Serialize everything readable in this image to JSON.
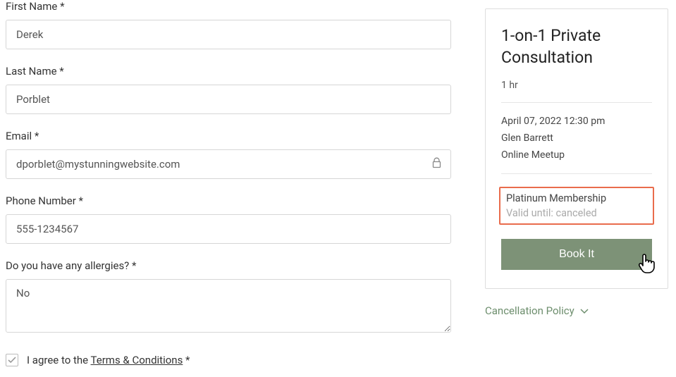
{
  "form": {
    "first_name": {
      "label": "First Name *",
      "value": "Derek"
    },
    "last_name": {
      "label": "Last Name *",
      "value": "Porblet"
    },
    "email": {
      "label": "Email *",
      "value": "dporblet@mystunningwebsite.com"
    },
    "phone": {
      "label": "Phone Number *",
      "value": "555-1234567"
    },
    "allergies": {
      "label": "Do you have any allergies? *",
      "value": "No"
    },
    "agree_prefix": "I agree to the ",
    "terms_link": "Terms & Conditions",
    "agree_suffix": " *"
  },
  "summary": {
    "title": "1-on-1 Private Consultation",
    "duration": "1 hr",
    "datetime": "April 07, 2022 12:30 pm",
    "provider": "Glen Barrett",
    "location": "Online Meetup",
    "membership_name": "Platinum Membership",
    "membership_valid": "Valid until: canceled",
    "book_label": "Book It",
    "cancel_policy": "Cancellation Policy"
  }
}
